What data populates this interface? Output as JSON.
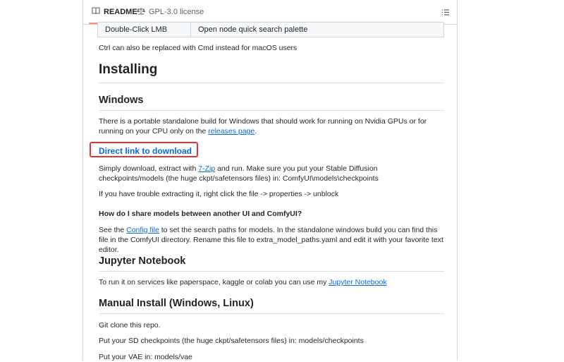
{
  "tabs": {
    "readme_label": "README",
    "license_label": "GPL-3.0 license"
  },
  "shortcut_row": {
    "key": "Double-Click LMB",
    "action": "Open node quick search palette"
  },
  "cmd_note": "Ctrl can also be replaced with Cmd instead for macOS users",
  "installing_heading": "Installing",
  "windows": {
    "heading": "Windows",
    "text_1": "There is a portable standalone build for Windows that should work for running on Nvidia GPUs or for running on your CPU only on the ",
    "releases_link": "releases page",
    "text_2": ".",
    "direct_link": "Direct link to download",
    "extract_1": "Simply download, extract with ",
    "zip_link": "7-Zip",
    "extract_2": " and run. Make sure you put your Stable Diffusion checkpoints/models (the huge ckpt/safetensors files) in: ComfyUI\\models\\checkpoints",
    "trouble": "If you have trouble extracting it, right click the file -> properties -> unblock",
    "share_heading": "How do I share models between another UI and ComfyUI?",
    "see_1": "See the ",
    "config_link": "Config file",
    "see_2": " to set the search paths for models. In the standalone windows build you can find this file in the ComfyUI directory. Rename this file to extra_model_paths.yaml and edit it with your favorite text editor."
  },
  "jupyter": {
    "heading": "Jupyter Notebook",
    "text_1": "To run it on services like paperspace, kaggle or colab you can use my ",
    "link": "Jupyter Notebook"
  },
  "manual": {
    "heading": "Manual Install (Windows, Linux)",
    "git_clone": "Git clone this repo.",
    "checkpoints": "Put your SD checkpoints (the huge ckpt/safetensors files) in: models/checkpoints",
    "vae": "Put your VAE in: models/vae"
  },
  "colors": {
    "link": "#0969da",
    "highlight": "#e03535",
    "tab_underline": "#fd8c73"
  }
}
